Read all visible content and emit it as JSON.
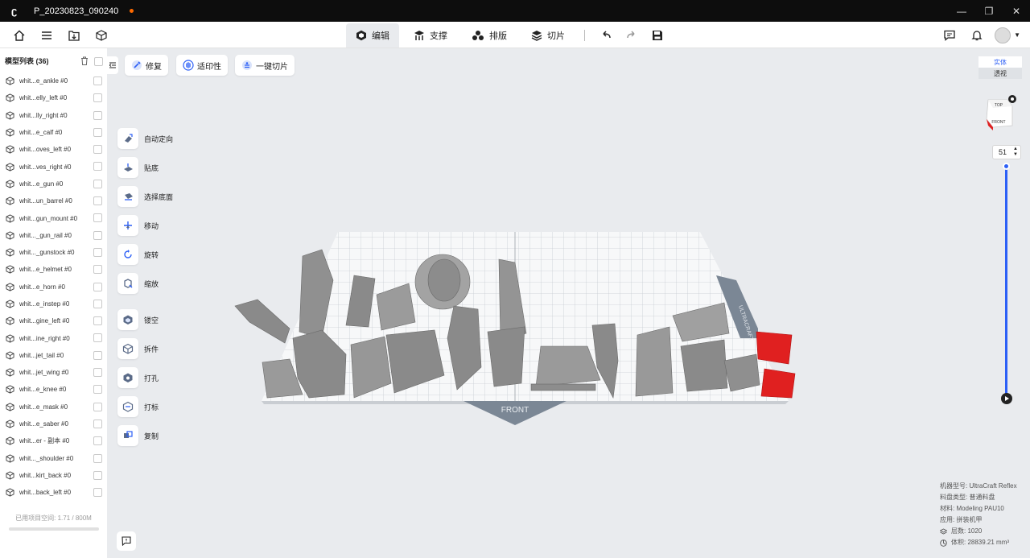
{
  "window": {
    "title": "P_20230823_090240",
    "controls": [
      "—",
      "❐",
      "✕"
    ]
  },
  "toolbar": {
    "tabs": [
      {
        "label": "编辑",
        "icon": "edit-cube-icon",
        "active": true
      },
      {
        "label": "支撑",
        "icon": "support-icon",
        "active": false
      },
      {
        "label": "排版",
        "icon": "layout-icon",
        "active": false
      },
      {
        "label": "切片",
        "icon": "slice-layers-icon",
        "active": false
      }
    ]
  },
  "sidebar": {
    "title": "模型列表 (36)",
    "items": [
      "whit...e_ankle #0",
      "whit...elly_left #0",
      "whit...lly_right #0",
      "whit...e_calf #0",
      "whit...oves_left #0",
      "whit...ves_right #0",
      "whit...e_gun #0",
      "whit...un_barrel #0",
      "whit...gun_mount #0",
      "whit..._gun_rail #0",
      "whit..._gunstock #0",
      "whit...e_helmet #0",
      "whit...e_horn #0",
      "whit...e_instep #0",
      "whit...gine_left #0",
      "whit...ine_right #0",
      "whit...jet_tail #0",
      "whit...jet_wing #0",
      "whit...e_knee #0",
      "whit...e_mask #0",
      "whit...e_saber #0",
      "whit...er - 副本 #0",
      "whit..._shoulder #0",
      "whit...kirt_back #0",
      "whit...back_left #0"
    ],
    "footer": "已用项目空间: 1.71 / 800M",
    "usage_fraction": 0.002
  },
  "actions": [
    "修复",
    "适印性",
    "一键切片"
  ],
  "tools": [
    "自动定向",
    "贴底",
    "选择底面",
    "移动",
    "旋转",
    "缩放",
    "镂空",
    "拆件",
    "打孔",
    "打标",
    "复制"
  ],
  "view": {
    "modes": [
      "实体",
      "透视"
    ],
    "cube_top": "TOP",
    "cube_front": "FRONT",
    "plate_front_label": "FRONT",
    "plate_side_label": "ULTRACRAFT"
  },
  "layer_slider": {
    "value": "51"
  },
  "info": {
    "machine": "机器型号: UltraCraft Reflex",
    "tray": "料盘类型: 普通料盘",
    "material": "材料: Modeling PAU10",
    "application": "应用: 拼装机甲",
    "layers": "层数: 1020",
    "volume": "体积: 28839.21 mm³"
  },
  "colors": {
    "accent": "#2c5ff6",
    "selected_model": "#e02020",
    "model": "#8a8a8a"
  }
}
